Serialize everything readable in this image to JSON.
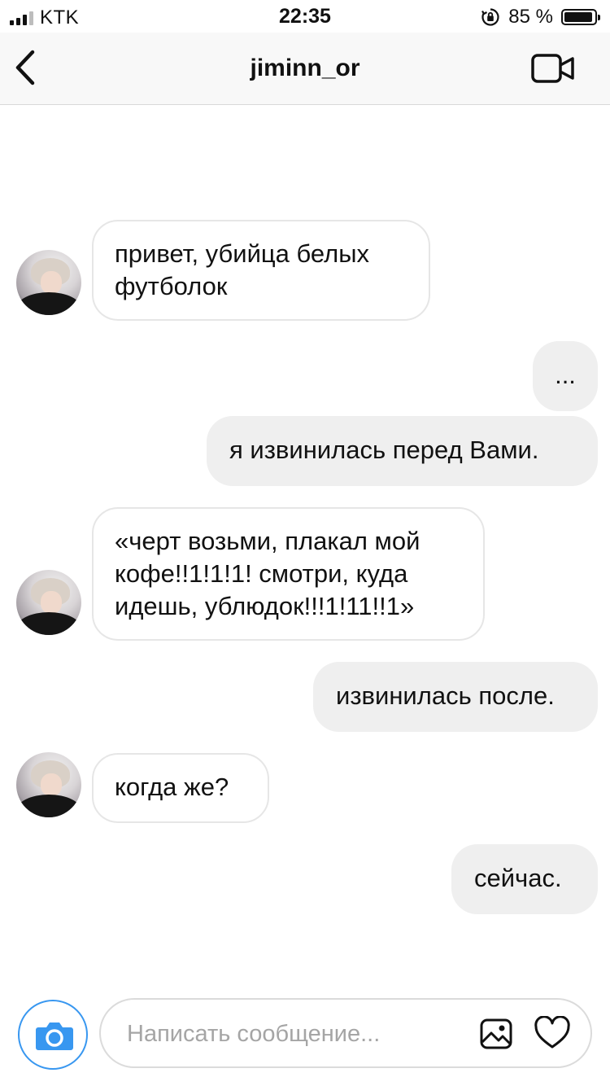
{
  "status_bar": {
    "carrier": "KTK",
    "time": "22:35",
    "battery_percent": "85 %"
  },
  "header": {
    "title": "jiminn_or",
    "back_icon": "chevron-left-icon",
    "video_icon": "video-camera-icon"
  },
  "messages": [
    {
      "from": "them",
      "text": "привет, убийца белых футболок"
    },
    {
      "from": "me",
      "text": "..."
    },
    {
      "from": "me",
      "text": "я извинилась перед Вами."
    },
    {
      "from": "them",
      "text": "«черт возьми, плакал мой кофе!!1!1!1! смотри, куда идешь, ублюдок!!!1!11!!1»"
    },
    {
      "from": "me",
      "text": "извинилась после."
    },
    {
      "from": "them",
      "text": "когда же?"
    },
    {
      "from": "me",
      "text": "сейчас."
    }
  ],
  "composer": {
    "placeholder": "Написать сообщение...",
    "value": "",
    "camera_icon": "camera-icon",
    "gallery_icon": "gallery-icon",
    "heart_icon": "heart-icon"
  },
  "colors": {
    "accent": "#3897f0",
    "outgoing_bubble": "#efefef",
    "incoming_border": "#e6e6e6"
  }
}
